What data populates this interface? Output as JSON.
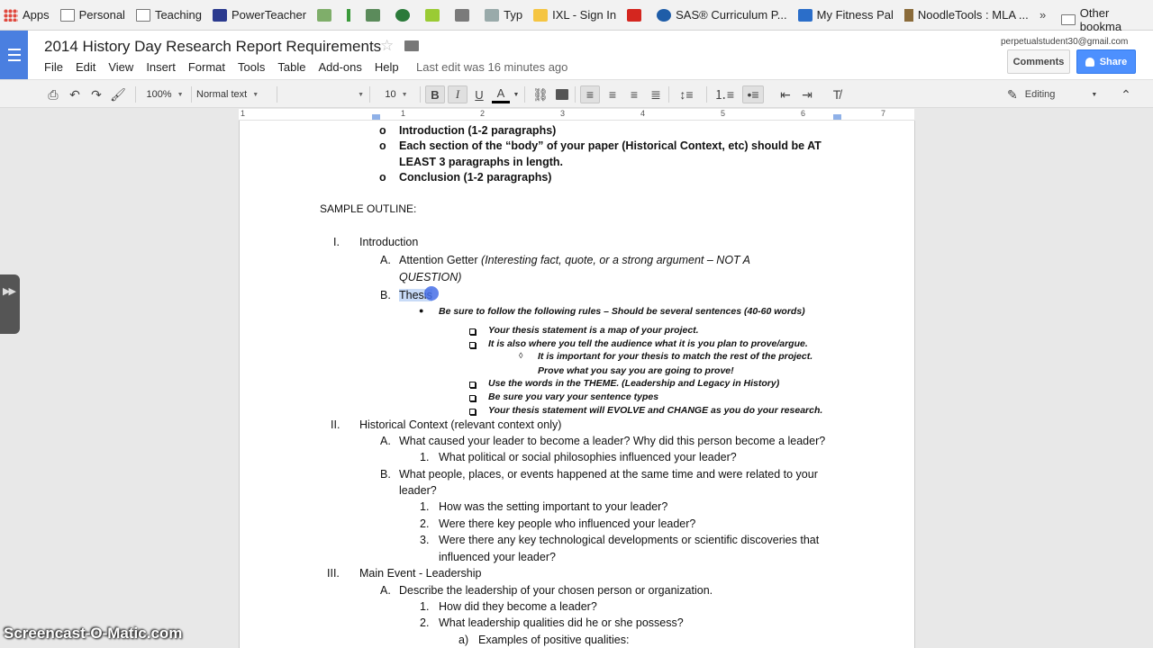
{
  "bookmarks": {
    "apps": "Apps",
    "personal": "Personal",
    "teaching": "Teaching",
    "powerteacher": "PowerTeacher",
    "typ": "Typ",
    "ixl": "IXL - Sign In",
    "sas": "SAS® Curriculum P...",
    "fitness": "My Fitness Pal",
    "noodletools": "NoodleTools : MLA ...",
    "more": "»",
    "other": "Other bookma"
  },
  "header": {
    "title": "2014 History Day Research Report Requirements",
    "last_edit": "Last edit was 16 minutes ago",
    "user_email": "perpetualstudent30@gmail.com",
    "comments_label": "Comments",
    "share_label": "Share"
  },
  "menu": [
    "File",
    "Edit",
    "View",
    "Insert",
    "Format",
    "Tools",
    "Table",
    "Add-ons",
    "Help"
  ],
  "toolbar": {
    "zoom": "100%",
    "style": "Normal text",
    "font_size": "10",
    "editing_mode": "Editing"
  },
  "ruler": [
    "1",
    "1",
    "2",
    "3",
    "4",
    "5",
    "6",
    "7"
  ],
  "doc": {
    "l1": "Introduction (1-2 paragraphs)",
    "l2": "Each section of the “body” of your paper (Historical Context, etc) should be AT",
    "l3": "LEAST 3 paragraphs in length.",
    "l4": "Conclusion (1-2 paragraphs)",
    "sample": "SAMPLE OUTLINE:",
    "I_marker": "I.",
    "I_text": "Introduction",
    "IA_marker": "A.",
    "IA_text": "Attention Getter ",
    "IA_italic1": "(Interesting fact, quote, or a strong argument – NOT A",
    "IA_italic2": "QUESTION)",
    "IB_marker": "B.",
    "IB_text": "Thesis",
    "bullet_rule": "Be sure to follow the following rules – Should be several sentences (40-60 words)",
    "r1": "Your thesis statement is a map of your project.",
    "r2": "It is also where you tell the audience what it is you plan to prove/argue.",
    "r2a": "It is important for your thesis to match the rest of the project.",
    "r2b": "Prove what you say you are going to prove!",
    "r3": "Use the words in the THEME.  (Leadership and Legacy in History)",
    "r4": "Be sure you vary your sentence types",
    "r5": "Your thesis statement will EVOLVE and CHANGE as you do your research.",
    "II_marker": "II.",
    "II_text": "Historical Context (relevant context only)",
    "IIA_marker": "A.",
    "IIA_text": "What caused your leader to become a leader?  Why did this person become a leader?",
    "IIA1_marker": "1.",
    "IIA1_text": "What political or social philosophies influenced your leader?",
    "IIB_marker": "B.",
    "IIB_text1": "What people, places, or events happened at the same time and were related to your",
    "IIB_text2": "leader?",
    "IIB1_marker": "1.",
    "IIB1_text": "How was the setting important to your leader?",
    "IIB2_marker": "2.",
    "IIB2_text": "Were there key people who influenced your leader?",
    "IIB3_marker": "3.",
    "IIB3_text1": "Were there any key technological developments or scientific discoveries that",
    "IIB3_text2": "influenced your leader?",
    "III_marker": "III.",
    "III_text": "Main Event - Leadership",
    "IIIA_marker": "A.",
    "IIIA_text": "Describe the leadership of your chosen person or organization.",
    "IIIA1_marker": "1.",
    "IIIA1_text": "How did they become a leader?",
    "IIIA2_marker": "2.",
    "IIIA2_text": "What leadership qualities did he or she possess?",
    "IIIA2a_marker": "a)",
    "IIIA2a_text": "Examples of positive qualities:"
  },
  "watermark": "Screencast-O-Matic.com"
}
